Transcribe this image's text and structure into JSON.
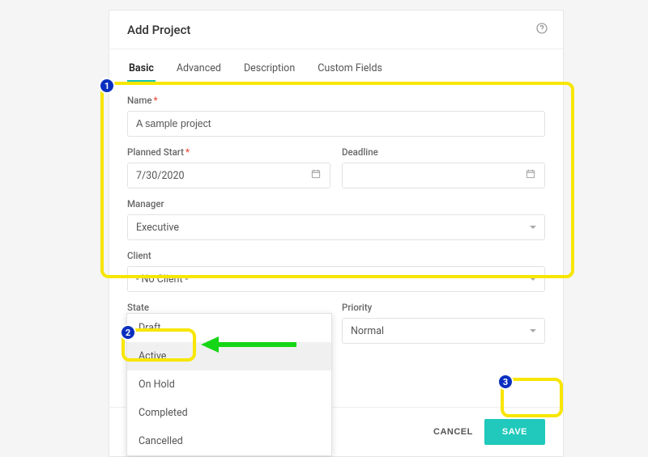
{
  "header": {
    "title": "Add Project"
  },
  "tabs": [
    {
      "label": "Basic",
      "active": true
    },
    {
      "label": "Advanced"
    },
    {
      "label": "Description"
    },
    {
      "label": "Custom Fields"
    }
  ],
  "labels": {
    "name": "Name",
    "planned_start": "Planned Start",
    "deadline": "Deadline",
    "manager": "Manager",
    "client": "Client",
    "state": "State",
    "priority": "Priority"
  },
  "fields": {
    "name": "A sample project",
    "planned_start": "7/30/2020",
    "deadline": "",
    "manager": "Executive",
    "client": "- No Client -",
    "state": "Active",
    "priority": "Normal"
  },
  "state_options": [
    "Draft",
    "Active",
    "On Hold",
    "Completed",
    "Cancelled"
  ],
  "footer": {
    "cancel": "CANCEL",
    "save": "SAVE"
  },
  "annotations": {
    "1": "1",
    "2": "2",
    "3": "3"
  }
}
